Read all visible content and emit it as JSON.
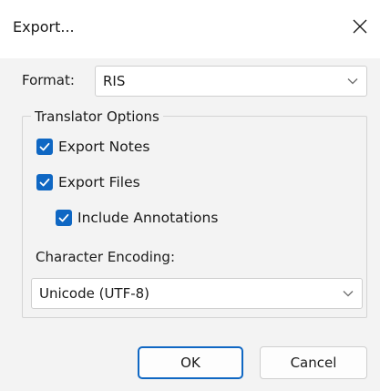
{
  "window": {
    "title": "Export...",
    "close_icon": "close-icon"
  },
  "format": {
    "label": "Format:",
    "selected": "RIS"
  },
  "translator_options": {
    "legend": "Translator Options",
    "export_notes": {
      "label": "Export Notes",
      "checked": true
    },
    "export_files": {
      "label": "Export Files",
      "checked": true
    },
    "include_annotations": {
      "label": "Include Annotations",
      "checked": true
    }
  },
  "encoding": {
    "label": "Character Encoding:",
    "selected": "Unicode (UTF-8)"
  },
  "buttons": {
    "ok": "OK",
    "cancel": "Cancel"
  },
  "colors": {
    "accent": "#0f67c3",
    "dialog_bg": "#f3f3f3",
    "titlebar_bg": "#ffffff"
  }
}
